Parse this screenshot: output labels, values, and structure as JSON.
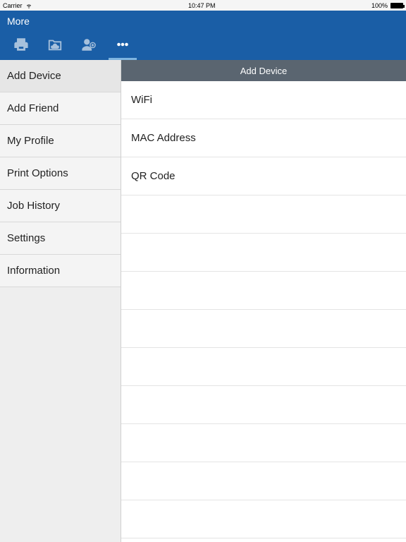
{
  "statusbar": {
    "carrier": "Carrier",
    "time": "10:47 PM",
    "battery_pct": "100%"
  },
  "navbar": {
    "title": "More"
  },
  "toolbar": {
    "tabs": [
      "print",
      "cloud-folder",
      "add-friend",
      "more"
    ],
    "active_index": 3
  },
  "sidebar": {
    "items": [
      {
        "label": "Add Device",
        "selected": true
      },
      {
        "label": "Add Friend",
        "selected": false
      },
      {
        "label": "My Profile",
        "selected": false
      },
      {
        "label": "Print Options",
        "selected": false
      },
      {
        "label": "Job History",
        "selected": false
      },
      {
        "label": "Settings",
        "selected": false
      },
      {
        "label": "Information",
        "selected": false
      }
    ]
  },
  "main": {
    "header": "Add Device",
    "rows": [
      {
        "label": "WiFi"
      },
      {
        "label": "MAC Address"
      },
      {
        "label": "QR Code"
      }
    ]
  },
  "colors": {
    "brand": "#1a5ea6",
    "section_header": "#5a6570",
    "sidebar_bg": "#eeeeee"
  }
}
